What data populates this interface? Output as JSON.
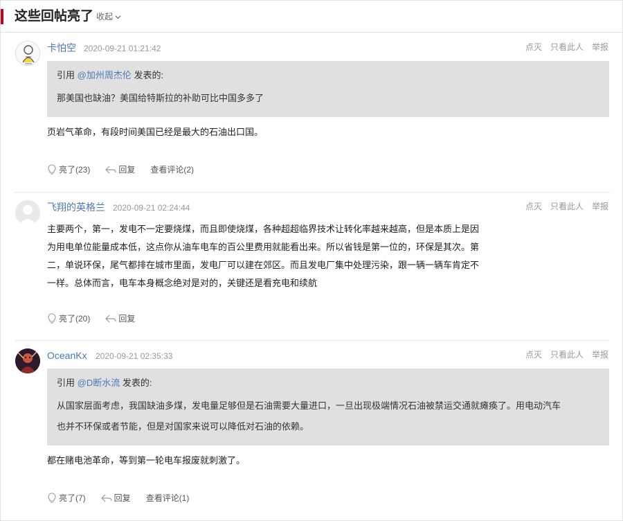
{
  "header": {
    "title": "这些回帖亮了",
    "collapse_label": "收起"
  },
  "top_actions": {
    "hide": "点灭",
    "only_this": "只看此人",
    "report": "举报"
  },
  "replies": [
    {
      "username": "卡怕空",
      "time": "2020-09-21 01:21:42",
      "quote": {
        "prefix": "引用",
        "user": "@加州周杰伦",
        "suffix": "发表的:",
        "lines": [
          "那美国也缺油？美国给特斯拉的补助可比中国多多了"
        ]
      },
      "body": [
        "页岩气革命，有段时间美国已经是最大的石油出口国。"
      ],
      "like": "亮了(23)",
      "reply": "回复",
      "comments": "查看评论(2)"
    },
    {
      "username": "飞翔的英格兰",
      "time": "2020-09-21 02:24:44",
      "body": [
        "主要两个，第一，发电不一定要烧煤，而且即使烧煤，各种超超临界技术让转化率越来越高，但是本质上是因",
        "为用电单位能量成本低，这点你从油车电车的百公里费用就能看出来。所以省钱是第一位的，环保是其次。第",
        "二，单说环保，尾气都排在城市里面，发电厂可以建在郊区。而且发电厂集中处理污染，跟一辆一辆车肯定不",
        "一样。总体而言，电车本身概念绝对是对的，关键还是看充电和续航"
      ],
      "like": "亮了(20)",
      "reply": "回复"
    },
    {
      "username": "OceanKx",
      "time": "2020-09-21 02:35:33",
      "quote": {
        "prefix": "引用",
        "user": "@D断水流",
        "suffix": "发表的:",
        "lines": [
          "从国家层面考虑，我国缺油多煤，发电量足够但是石油需要大量进口，一旦出现极端情况石油被禁运交通就瘫痪了。用电动汽车",
          "也并不环保或者节能，但是对国家来说可以降低对石油的依赖。"
        ]
      },
      "body": [
        "都在赌电池革命，等到第一轮电车报废就刺激了。"
      ],
      "like": "亮了(7)",
      "reply": "回复",
      "comments": "查看评论(1)"
    }
  ],
  "colors": {
    "accent": "#c8001b",
    "link": "#4a79b8",
    "quote_bg": "#e0e0e0",
    "muted": "#999999"
  }
}
